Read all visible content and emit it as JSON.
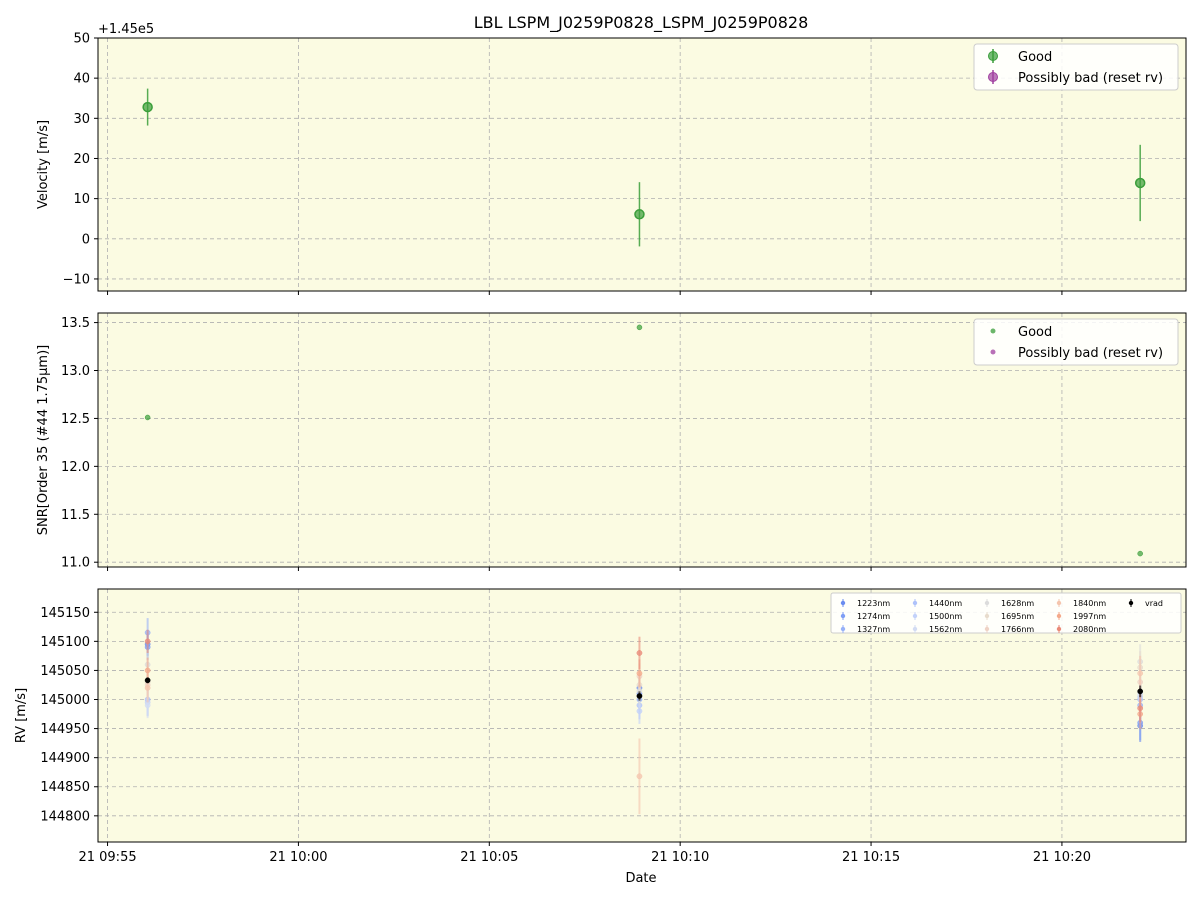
{
  "title": "LBL LSPM_J0259P0828_LSPM_J0259P0828",
  "xlabel": "Date",
  "x_ticks": [
    "21 09:55",
    "21 10:00",
    "21 10:05",
    "21 10:10",
    "21 10:15",
    "21 10:20"
  ],
  "colors": {
    "good": "#3a9e3a",
    "bad": "#a040a0",
    "panel_bg": "#fbfbe2",
    "vrad": "#000000"
  },
  "chart_data": [
    {
      "type": "scatter",
      "ylabel": "Velocity [m/s]",
      "offset_label": "+1.45e5",
      "ylim": [
        -13,
        50
      ],
      "y_ticks": [
        "50",
        "40",
        "30",
        "20",
        "10",
        "0",
        "−10"
      ],
      "y_tick_values": [
        50,
        40,
        30,
        20,
        10,
        0,
        -10
      ],
      "legend": [
        "Good",
        "Possibly bad (reset rv)"
      ],
      "legend_position": "top-right",
      "grid": true,
      "series": [
        {
          "name": "Good",
          "x": [
            "09:56:03",
            "10:08:56",
            "10:22:03"
          ],
          "y": [
            32.8,
            6.1,
            13.9
          ],
          "err": [
            4.6,
            8.0,
            9.5
          ]
        },
        {
          "name": "Possibly bad (reset rv)",
          "x": [],
          "y": [],
          "err": []
        }
      ]
    },
    {
      "type": "scatter",
      "ylabel": "SNR[Order 35 (#44 1.75μm)]",
      "ylim": [
        10.95,
        13.6
      ],
      "y_ticks": [
        "13.5",
        "13.0",
        "12.5",
        "12.0",
        "11.5",
        "11.0"
      ],
      "y_tick_values": [
        13.5,
        13.0,
        12.5,
        12.0,
        11.5,
        11.0
      ],
      "legend": [
        "Good",
        "Possibly bad (reset rv)"
      ],
      "legend_position": "top-right",
      "grid": true,
      "series": [
        {
          "name": "Good",
          "x": [
            "09:56:03",
            "10:08:56",
            "10:22:03"
          ],
          "y": [
            12.51,
            13.45,
            11.09
          ]
        },
        {
          "name": "Possibly bad (reset rv)",
          "x": [],
          "y": []
        }
      ]
    },
    {
      "type": "scatter",
      "ylabel": "RV [m/s]",
      "ylim": [
        144755,
        145190
      ],
      "y_ticks": [
        "145150",
        "145100",
        "145050",
        "145000",
        "144950",
        "144900",
        "144850",
        "144800"
      ],
      "y_tick_values": [
        145150,
        145100,
        145050,
        145000,
        144950,
        144900,
        144850,
        144800
      ],
      "legend_position": "top-right",
      "grid": true,
      "series": [
        {
          "name": "1223nm",
          "color": "#6a8cf0",
          "x": [
            "09:56:03",
            "10:08:56",
            "10:22:03"
          ],
          "y": [
            145095,
            145020,
            144955
          ],
          "err": [
            20,
            18,
            28
          ]
        },
        {
          "name": "1274nm",
          "color": "#7f9ef5",
          "x": [
            "09:56:03",
            "10:08:56",
            "10:22:03"
          ],
          "y": [
            145090,
            145010,
            144960
          ],
          "err": [
            22,
            20,
            30
          ]
        },
        {
          "name": "1327nm",
          "color": "#97b1f8",
          "x": [
            "09:56:03",
            "10:08:56",
            "10:22:03"
          ],
          "y": [
            145115,
            145000,
            144990
          ],
          "err": [
            25,
            22,
            26
          ]
        },
        {
          "name": "1440nm",
          "color": "#aec2fa",
          "x": [
            "09:56:03",
            "10:08:56",
            "10:22:03"
          ],
          "y": [
            145000,
            144990,
            145000
          ],
          "err": [
            28,
            24,
            30
          ]
        },
        {
          "name": "1500nm",
          "color": "#c3d2fa",
          "x": [
            "09:56:03",
            "10:08:56",
            "10:22:03"
          ],
          "y": [
            144995,
            144980,
            145005
          ],
          "err": [
            24,
            22,
            28
          ]
        },
        {
          "name": "1562nm",
          "color": "#d3dcf3",
          "x": [
            "09:56:03",
            "10:08:56",
            "10:22:03"
          ],
          "y": [
            144990,
            145005,
            145010
          ],
          "err": [
            22,
            20,
            24
          ]
        },
        {
          "name": "1628nm",
          "color": "#dcdcdc",
          "x": [
            "09:56:03",
            "10:08:56",
            "10:22:03"
          ],
          "y": [
            145060,
            145015,
            145065
          ],
          "err": [
            26,
            24,
            30
          ]
        },
        {
          "name": "1695nm",
          "color": "#e8dccd",
          "x": [
            "09:56:03",
            "10:08:56",
            "10:22:03"
          ],
          "y": [
            145030,
            145025,
            145055
          ],
          "err": [
            24,
            22,
            28
          ]
        },
        {
          "name": "1766nm",
          "color": "#efd3c6",
          "x": [
            "09:56:03",
            "10:08:56",
            "10:22:03"
          ],
          "y": [
            145025,
            145040,
            145030
          ],
          "err": [
            24,
            22,
            28
          ]
        },
        {
          "name": "1840nm",
          "color": "#f5c5ae",
          "x": [
            "09:56:03",
            "10:08:56",
            "10:22:03"
          ],
          "y": [
            145020,
            144868,
            145045
          ],
          "err": [
            25,
            65,
            30
          ]
        },
        {
          "name": "1997nm",
          "color": "#f4a98b",
          "x": [
            "09:56:03",
            "10:08:56",
            "10:22:03"
          ],
          "y": [
            145050,
            145045,
            144975
          ],
          "err": [
            22,
            24,
            26
          ]
        },
        {
          "name": "2080nm",
          "color": "#ea8a78",
          "x": [
            "09:56:03",
            "10:08:56",
            "10:22:03"
          ],
          "y": [
            145100,
            145080,
            144985
          ],
          "err": [
            20,
            28,
            24
          ]
        },
        {
          "name": "vrad",
          "color": "#000000",
          "x": [
            "09:56:03",
            "10:08:56",
            "10:22:03"
          ],
          "y": [
            145033,
            145006,
            145014
          ],
          "err": [
            5,
            8,
            10
          ]
        }
      ]
    }
  ]
}
